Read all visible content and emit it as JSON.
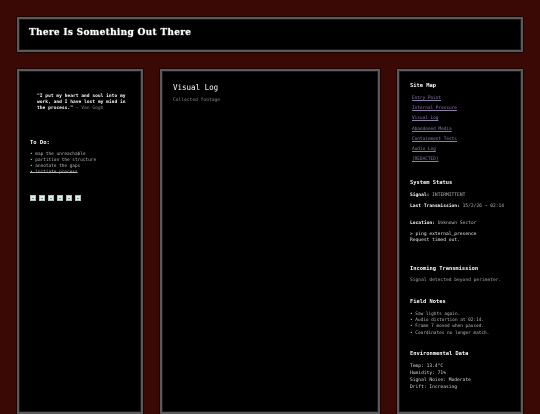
{
  "header": {
    "title": "There Is Something Out There"
  },
  "left": {
    "quote": "\"I put my heart and soul into my work, and I have lost my mind in the process.\"",
    "quote_attribution": "— Van Gogh",
    "todo_title": "To Do:",
    "todos": [
      {
        "label": "map the unreachable",
        "done": false
      },
      {
        "label": "partition the structure",
        "done": false
      },
      {
        "label": "annotate the gaps",
        "done": false
      },
      {
        "label": "initiate process",
        "done": true
      }
    ],
    "images_count": 6
  },
  "center": {
    "title": "Visual Log",
    "subtitle": "Collected footage"
  },
  "right": {
    "sitemap_title": "Site Map",
    "sitemap": [
      "Entry Point",
      "Internal Pressure",
      "Visual Log",
      "Abandoned Media",
      "Containment Tests",
      "Audio Log",
      "[REDACTED]"
    ],
    "status_title": "System Status",
    "signal_label": "Signal:",
    "signal_value": "INTERMITTENT",
    "last_tx_label": "Last Transmission:",
    "last_tx_value": "15/2/26 — 02:14",
    "location_label": "Location:",
    "location_value": "Unknown Sector",
    "ping_cmd": "> ping external_presence",
    "ping_result": "Request timed out.",
    "incoming_title": "Incoming Transmission",
    "incoming_text": "Signal detected beyond perimeter.",
    "notes_title": "Field Notes",
    "notes": [
      "Saw lights again.",
      "Audio distortion at 02:14.",
      "Frame 7 moved when paused.",
      "Coordinates no longer match."
    ],
    "env_title": "Environmental Data",
    "env": [
      "Temp: 13.4°C",
      "Humidity: 71%",
      "Signal Noise: Moderate",
      "Drift: Increasing"
    ]
  },
  "colors": {
    "background": "#3a0905",
    "panel": "#000000",
    "border": "#5a5a5a",
    "link": "#8f7ea8"
  }
}
